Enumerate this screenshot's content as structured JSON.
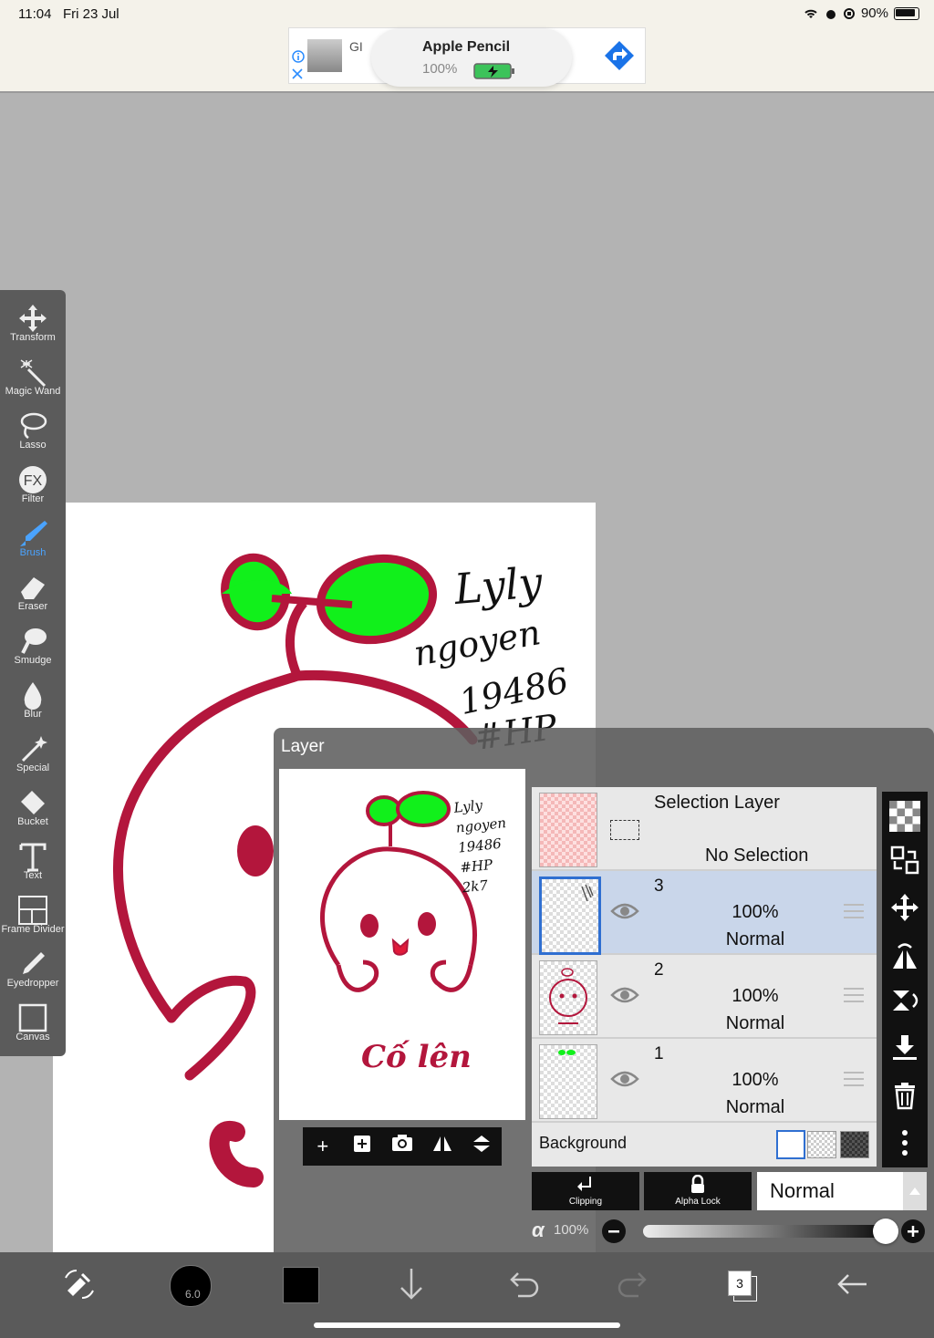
{
  "status_bar": {
    "time": "11:04",
    "date": "Fri 23 Jul",
    "battery": "90%"
  },
  "ad_banner": {
    "title": "Apple Pencil",
    "charge": "100%",
    "brand_text": "GI"
  },
  "tools": [
    {
      "label": "Transform",
      "icon": "move-arrows-icon"
    },
    {
      "label": "Magic Wand",
      "icon": "magic-wand-icon"
    },
    {
      "label": "Lasso",
      "icon": "lasso-icon"
    },
    {
      "label": "Filter",
      "icon": "fx-icon"
    },
    {
      "label": "Brush",
      "icon": "brush-icon",
      "active": true
    },
    {
      "label": "Eraser",
      "icon": "eraser-icon"
    },
    {
      "label": "Smudge",
      "icon": "smudge-icon"
    },
    {
      "label": "Blur",
      "icon": "drop-icon"
    },
    {
      "label": "Special",
      "icon": "special-icon"
    },
    {
      "label": "Bucket",
      "icon": "bucket-icon"
    },
    {
      "label": "Text",
      "icon": "text-icon"
    },
    {
      "label": "Frame Divider",
      "icon": "frame-divider-icon"
    },
    {
      "label": "Eyedropper",
      "icon": "eyedropper-icon"
    },
    {
      "label": "Canvas",
      "icon": "canvas-icon"
    }
  ],
  "canvas_text": {
    "line1": "Lyly",
    "line2": "ngoyen",
    "line3": "19486",
    "line4": "#HP",
    "line5": "2k7",
    "bottom": "Cố lên"
  },
  "layer_panel": {
    "title": "Layer",
    "selection_layer": {
      "title": "Selection Layer",
      "status": "No Selection"
    },
    "layers": [
      {
        "number": "3",
        "opacity": "100%",
        "blend": "Normal",
        "selected": true
      },
      {
        "number": "2",
        "opacity": "100%",
        "blend": "Normal",
        "selected": false
      },
      {
        "number": "1",
        "opacity": "100%",
        "blend": "Normal",
        "selected": false
      }
    ],
    "background_label": "Background",
    "clipping_label": "Clipping",
    "alpha_lock_label": "Alpha Lock",
    "blend_mode": "Normal",
    "alpha_symbol": "α",
    "alpha_value": "100%",
    "alpha_level": 1.0
  },
  "bottom_bar": {
    "brush_size": "6.0",
    "layer_count": "3"
  },
  "colors": {
    "accent": "#4aa3ff",
    "sprout_green": "#11f01b",
    "ink_red": "#b3163c",
    "selected_row": "#c9d6ea"
  }
}
